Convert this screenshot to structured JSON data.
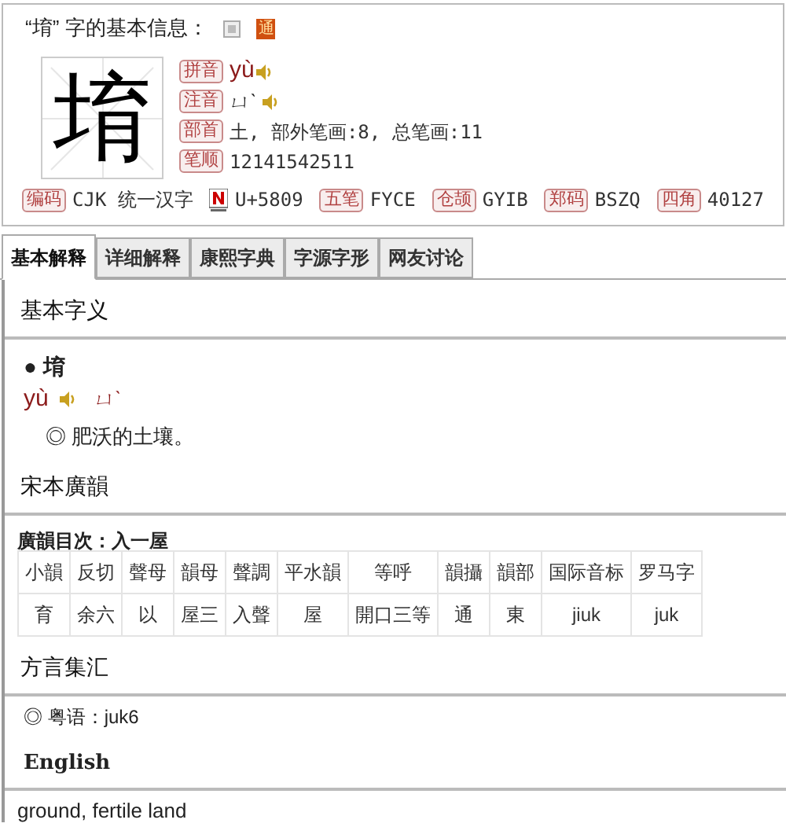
{
  "header": {
    "title": "“堉” 字的基本信息：",
    "badge": "通"
  },
  "character": "堉",
  "fields": [
    {
      "label": "拼音",
      "value": "yù",
      "kind": "pinyin"
    },
    {
      "label": "注音",
      "value": "ㄩˋ",
      "kind": "zhuyin"
    },
    {
      "label": "部首",
      "value": "土, 部外笔画:8, 总笔画:11",
      "kind": "text"
    },
    {
      "label": "笔顺",
      "value": "12141542511",
      "kind": "text"
    }
  ],
  "codes": [
    {
      "label": "编码",
      "value": "CJK 统一汉字",
      "kind": "tag"
    },
    {
      "value": "U+5809",
      "kind": "unicode"
    },
    {
      "label": "五笔",
      "value": "FYCE",
      "kind": "tag"
    },
    {
      "label": "仓颉",
      "value": "GYIB",
      "kind": "tag"
    },
    {
      "label": "郑码",
      "value": "BSZQ",
      "kind": "tag"
    },
    {
      "label": "四角",
      "value": "40127",
      "kind": "tag"
    }
  ],
  "tabs": [
    {
      "label": "基本解释",
      "selected": true
    },
    {
      "label": "详细解释",
      "selected": false
    },
    {
      "label": "康熙字典",
      "selected": false
    },
    {
      "label": "字源字形",
      "selected": false
    },
    {
      "label": "网友讨论",
      "selected": false
    }
  ],
  "basic": {
    "heading": "基本字义",
    "entry": "● 堉",
    "pinyin": "yù",
    "zhuyin": "ㄩˋ",
    "definition": "◎ 肥沃的土壤。"
  },
  "guangyun": {
    "heading": "宋本廣韻",
    "catalog": "廣韻目次：入一屋",
    "table": {
      "columns": [
        "小韻",
        "反切",
        "聲母",
        "韻母",
        "聲調",
        "平水韻",
        "等呼",
        "韻攝",
        "韻部",
        "国际音标",
        "罗马字"
      ],
      "rows": [
        [
          "育",
          "余六",
          "以",
          "屋三",
          "入聲",
          "屋",
          "開口三等",
          "通",
          "東",
          "jiuk",
          "juk"
        ]
      ]
    }
  },
  "dialect": {
    "heading": "方言集汇",
    "entry": "◎ 粤语：juk6"
  },
  "english": {
    "heading": "English",
    "text": "ground, fertile land"
  }
}
